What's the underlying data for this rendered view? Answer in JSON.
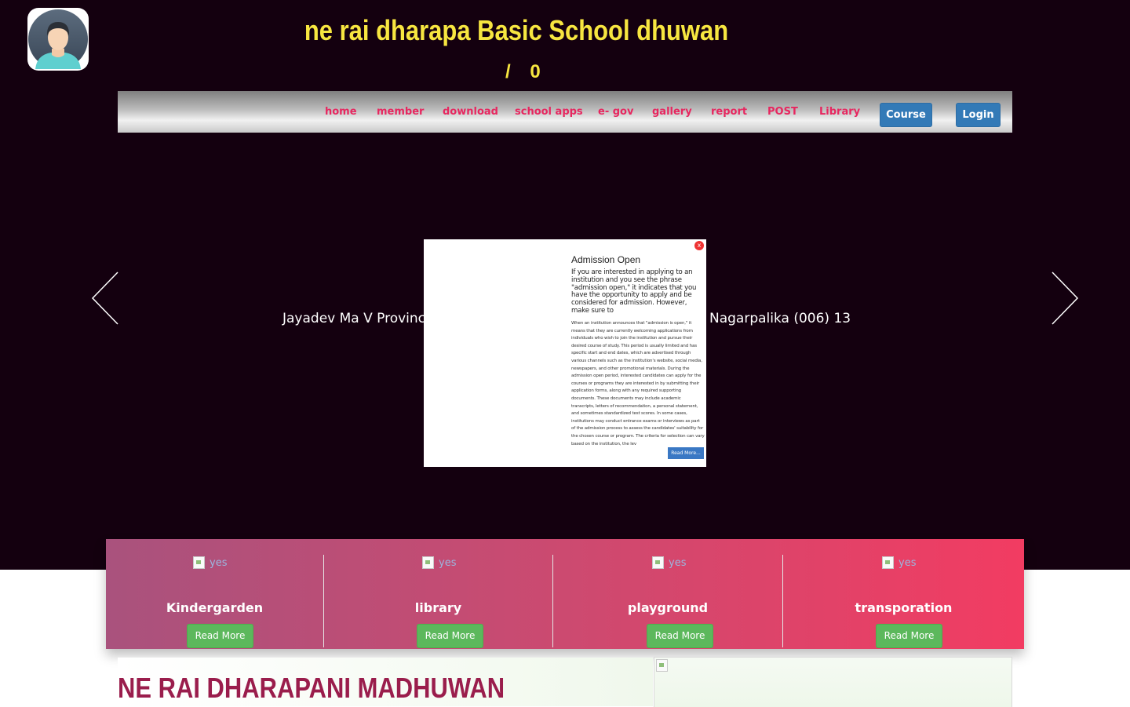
{
  "header": {
    "title": "ne rai dharapa Basic School dhuwan",
    "counter_slash": "/",
    "counter_value": "0",
    "logo_icon": "user-avatar-icon"
  },
  "nav": {
    "links": [
      "home",
      "member",
      "download",
      "school apps",
      "e- gov",
      "gallery",
      "report",
      "POST",
      "Library"
    ],
    "course_button": "Course",
    "login_button": "Login"
  },
  "slider": {
    "caption_left": "Jayadev Ma V Provinc",
    "caption_right": "Nagarpalika (006) 13",
    "prev_icon": "arrow-left-icon",
    "next_icon": "arrow-right-icon"
  },
  "popup": {
    "close": "x",
    "title": "Admission Open",
    "lead": "If you are interested in applying to an institution and you see the phrase \"admission open,\" it indicates that you have the opportunity to apply and be considered for admission. However, make sure to",
    "body": "When an institution announces that \"admission is open,\" it means that they are currently welcoming applications from individuals who wish to join the institution and pursue their desired course of study. This period is usually limited and has specific start and end dates, which are advertised through various channels such as the institution's website, social media, newspapers, and other promotional materials. During the admission open period, interested candidates can apply for the courses or programs they are interested in by submitting their application forms, along with any required supporting documents. These documents may include academic transcripts, letters of recommendation, a personal statement, and sometimes standardized test scores. In some cases, institutions may conduct entrance exams or interviews as part of the admission process to assess the candidates' suitability for the chosen course or program. The criteria for selection can vary based on the institution, the lev",
    "read_more": "Read More..."
  },
  "features": [
    {
      "img_alt": "yes",
      "title": "Kindergarden",
      "button": "Read More"
    },
    {
      "img_alt": "yes",
      "title": "library",
      "button": "Read More"
    },
    {
      "img_alt": "yes",
      "title": "playground",
      "button": "Read More"
    },
    {
      "img_alt": "yes",
      "title": "transporation",
      "button": "Read More"
    }
  ],
  "about": {
    "title": "NE RAI DHARAPANI MADHUWAN"
  },
  "colors": {
    "background": "#14000f",
    "title": "#f7e640",
    "nav_link": "#e7265f",
    "primary_button": "#337ab7",
    "success_button": "#5cb85c",
    "about_title": "#9a1d4c"
  }
}
